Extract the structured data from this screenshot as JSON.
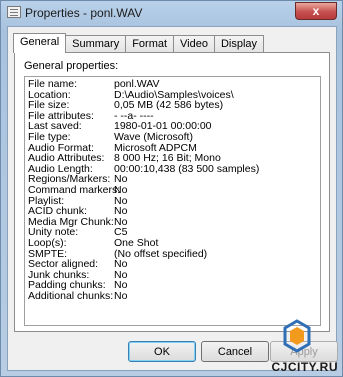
{
  "window": {
    "title": "Properties - ponl.WAV",
    "close_label": "x"
  },
  "tabs": [
    {
      "label": "General",
      "active": true
    },
    {
      "label": "Summary",
      "active": false
    },
    {
      "label": "Format",
      "active": false
    },
    {
      "label": "Video",
      "active": false
    },
    {
      "label": "Display",
      "active": false
    }
  ],
  "general": {
    "group_title": "General properties:",
    "rows": [
      {
        "key": "File name:",
        "value": "ponl.WAV"
      },
      {
        "key": "Location:",
        "value": "D:\\Audio\\Samples\\voices\\"
      },
      {
        "key": "File size:",
        "value": "0,05 MB (42 586 bytes)"
      },
      {
        "key": "File attributes:",
        "value": "- --a- ----"
      },
      {
        "key": "Last saved:",
        "value": "1980-01-01  00:00:00"
      },
      {
        "key": "File type:",
        "value": "Wave (Microsoft)"
      },
      {
        "key": "Audio Format:",
        "value": "Microsoft ADPCM"
      },
      {
        "key": "Audio Attributes:",
        "value": "8 000 Hz; 16 Bit; Mono"
      },
      {
        "key": "Audio Length:",
        "value": "00:00:10,438 (83 500 samples)"
      },
      {
        "key": "Regions/Markers:",
        "value": "No"
      },
      {
        "key": "Command markers:",
        "value": "No"
      },
      {
        "key": "Playlist:",
        "value": "No"
      },
      {
        "key": "ACID chunk:",
        "value": "No"
      },
      {
        "key": "Media Mgr Chunk:",
        "value": "No"
      },
      {
        "key": "Unity note:",
        "value": "C5"
      },
      {
        "key": "Loop(s):",
        "value": "One Shot"
      },
      {
        "key": "SMPTE:",
        "value": "(No offset specified)"
      },
      {
        "key": "Sector aligned:",
        "value": "No"
      },
      {
        "key": "Junk chunks:",
        "value": "No"
      },
      {
        "key": "Padding chunks:",
        "value": "No"
      },
      {
        "key": "Additional chunks:",
        "value": "No"
      }
    ]
  },
  "buttons": {
    "ok": "OK",
    "cancel": "Cancel",
    "apply": "Apply"
  },
  "watermark": {
    "text": "CJCITY.RU"
  },
  "colors": {
    "titlebar": "#b9d1ea",
    "close": "#c75050",
    "logo_orange": "#f29a1e",
    "logo_blue": "#2f6fb5"
  }
}
